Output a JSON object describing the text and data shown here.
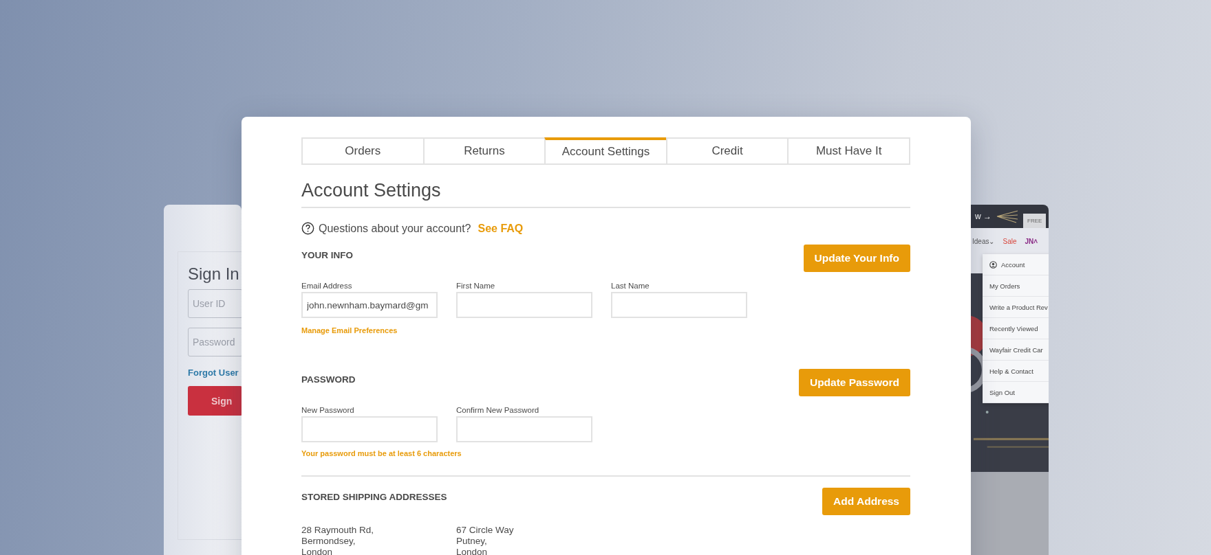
{
  "sign_in_window": {
    "title": "Sign In",
    "fields": [
      {
        "placeholder": "User ID"
      },
      {
        "placeholder": "Password"
      }
    ],
    "forgot_link": "Forgot User",
    "button": "Sign"
  },
  "store_window": {
    "promo": "w →",
    "tag": "FREE",
    "nav": [
      {
        "label": "Ideas",
        "caret": "⌄",
        "kind": "text"
      },
      {
        "label": "Sale",
        "kind": "sale"
      },
      {
        "label": "JN",
        "caret": "˄",
        "kind": "user"
      }
    ],
    "menu": [
      {
        "label": "Account",
        "kind": "icon"
      },
      {
        "label": "My Orders",
        "kind": "plain"
      },
      {
        "label": "Write a Product Rev",
        "kind": "plain"
      },
      {
        "label": "Recently Viewed",
        "kind": "plain"
      },
      {
        "label": "Wayfair Credit Car",
        "kind": "plain"
      },
      {
        "label": "Help & Contact",
        "kind": "plain"
      },
      {
        "label": "Sign Out",
        "kind": "plain"
      }
    ]
  },
  "tabs": [
    {
      "label": "Orders",
      "selected": false
    },
    {
      "label": "Returns",
      "selected": false
    },
    {
      "label": "Account Settings",
      "selected": true
    },
    {
      "label": "Credit",
      "selected": false
    },
    {
      "label": "Must Have It",
      "selected": false
    }
  ],
  "title": "Account Settings",
  "faq": {
    "text": "Questions about your account?",
    "link": "See FAQ"
  },
  "your_info": {
    "heading": "YOUR INFO",
    "button": "Update Your Info",
    "fields": [
      {
        "label": "Email Address",
        "value": "john.newnham.baymard@gm"
      },
      {
        "label": "First Name"
      },
      {
        "label": "Last Name"
      }
    ],
    "link": "Manage Email Preferences"
  },
  "password": {
    "heading": "PASSWORD",
    "button": "Update Password",
    "fields": [
      {
        "label": "New Password"
      },
      {
        "label": "Confirm New Password"
      }
    ],
    "hint": "Your password must be at least 6 characters"
  },
  "addresses": {
    "heading": "STORED SHIPPING ADDRESSES",
    "button": "Add Address",
    "items": [
      {
        "lines": [
          "28 Raymouth Rd,",
          "Bermondsey,",
          "London"
        ]
      },
      {
        "lines": [
          "67 Circle Way",
          "Putney,",
          "London"
        ]
      }
    ]
  }
}
